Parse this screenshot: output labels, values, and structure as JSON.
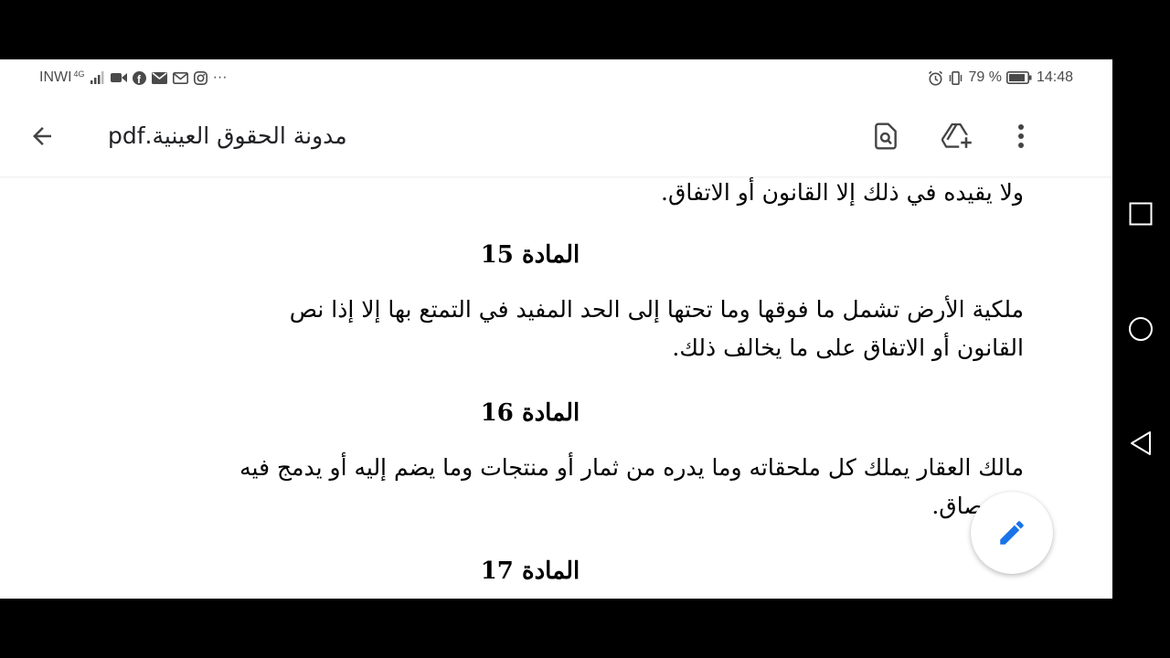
{
  "status_bar": {
    "carrier": "INWI",
    "network": "4G",
    "battery": "79 %",
    "time": "14:48",
    "more": "···"
  },
  "app_bar": {
    "title": "مدونة الحقوق العينية.pdf",
    "icons": [
      "back-arrow-icon",
      "find-in-document-icon",
      "add-to-drive-icon",
      "more-vert-icon"
    ]
  },
  "document": {
    "top_fragment": "ولا يقيده في ذلك إلا القانون أو الاتفاق.",
    "articles": [
      {
        "heading": "المادة 15",
        "lines": [
          "ملكية الأرض تشمل ما فوقها وما تحتها إلى الحد المفيد في التمتع بها إلا إذا نص",
          "القانون أو الاتفاق على ما يخالف ذلك."
        ]
      },
      {
        "heading": "المادة 16",
        "lines": [
          "مالك العقار يملك كل ملحقاته وما يدره من ثمار أو منتجات وما يضم إليه أو يدمج فيه",
          "بالالتصاق."
        ]
      },
      {
        "heading": "المادة 17",
        "lines": []
      }
    ]
  },
  "accent_color": "#1a73e8",
  "nav_bar": [
    "square-recents-icon",
    "circle-home-icon",
    "triangle-back-icon"
  ]
}
